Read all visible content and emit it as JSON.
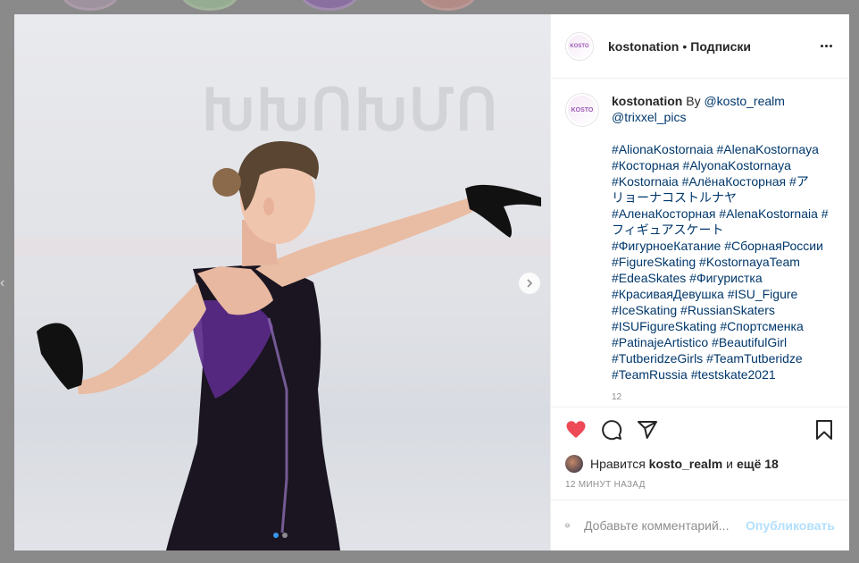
{
  "colors": {
    "heart": "#ed4956",
    "link": "#00376b",
    "publish_disabled": "#b2dffc",
    "backdrop": "#8a8a8a"
  },
  "post": {
    "header": {
      "username": "kostonation",
      "separator": "•",
      "follow_label": "Подписки",
      "avatar_text": "KOSTO"
    },
    "media": {
      "background_text": "ԽԽՈԽՄՈ",
      "carousel_dots": 2,
      "active_dot": 1
    },
    "caption": {
      "username": "kostonation",
      "by_word": "By",
      "author_link": "@kosto_realm",
      "photo_link": "@trixxel_pics",
      "hashtag_lines": [
        "#AlionaKostornaia #AlenaKostornaya",
        "#Косторная #AlyonaKostornaya",
        "#Kostornaia #АлёнаКосторная #ア",
        "リョーナコストルナヤ",
        "#АленаКосторная #AlenaKostornaia #",
        "フィギュアスケート",
        "#ФигурноеКатание #СборнаяРоссии",
        "#FigureSkating #KostornayaTeam",
        "#EdeaSkates #Фигуристка",
        "#КрасиваяДевушка #ISU_Figure",
        "#IceSkating #RussianSkaters",
        "#ISUFigureSkating #Спортсменка",
        "#PatinajeArtistico #BeautifulGirl",
        "#TutberidzeGirls #TeamTutberidze",
        "#TeamRussia #testskate2021"
      ],
      "cut_time": "12"
    },
    "likes": {
      "prefix": "Нравится",
      "user": "kosto_realm",
      "middle": "и",
      "rest": "ещё 18"
    },
    "timestamp": "12 МИНУТ НАЗАД",
    "comment": {
      "placeholder": "Добавьте комментарий...",
      "publish_label": "Опубликовать"
    }
  }
}
